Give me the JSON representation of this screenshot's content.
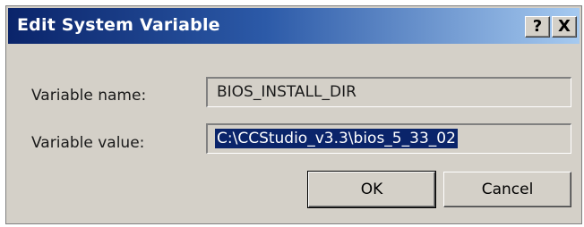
{
  "window": {
    "title": "Edit System Variable",
    "help_label": "?",
    "close_label": "X"
  },
  "form": {
    "name_label": "Variable name:",
    "name_value": "BIOS_INSTALL_DIR",
    "value_label": "Variable value:",
    "value_value": "C:\\CCStudio_v3.3\\bios_5_33_02"
  },
  "buttons": {
    "ok_label": "OK",
    "cancel_label": "Cancel"
  }
}
